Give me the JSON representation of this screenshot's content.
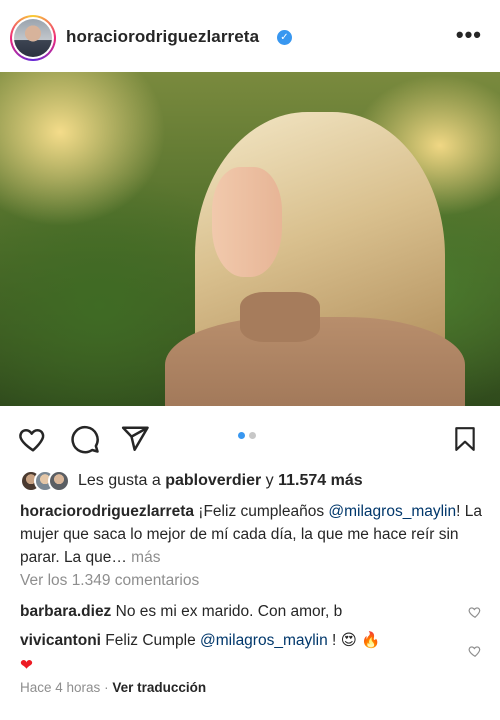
{
  "post": {
    "author": "horaciorodriguezlarreta",
    "verified_glyph": "✓",
    "more_glyph": "•••",
    "carousel": {
      "count": 2,
      "active": 1
    }
  },
  "likes": {
    "prefix": "Les gusta a",
    "user": "pabloverdier",
    "connector": "y",
    "count": "11.574 más"
  },
  "caption": {
    "user": "horaciorodriguezlarreta",
    "text1": " ¡Feliz cumpleaños ",
    "mention": "@milagros_maylin",
    "text2": "! La mujer que saca lo mejor de mí cada día, la que me hace reír sin parar. La que… ",
    "more": "más"
  },
  "view_comments": "Ver los 1.349 comentarios",
  "comments": [
    {
      "user": "barbara.diez",
      "text": "No es mi ex marido. Con amor, b"
    },
    {
      "user": "vivicantoni",
      "text1": "Feliz Cumple ",
      "mention": "@milagros_maylin",
      "text2": " ! ",
      "emoji1": "😍",
      "emoji2": "🔥",
      "emoji3": "❤"
    }
  ],
  "footer": {
    "time": "Hace 4 horas",
    "sep": "·",
    "translate": "Ver traducción"
  },
  "colors": {
    "accent": "#3897f0",
    "mention": "#00376b",
    "muted": "#8e8e8e",
    "heart": "#ed1b24"
  }
}
